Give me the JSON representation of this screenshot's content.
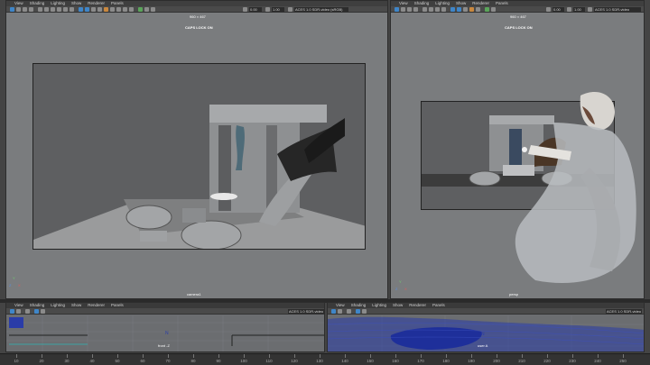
{
  "menus": [
    "View",
    "Shading",
    "Lighting",
    "Show",
    "Renderer",
    "Panels"
  ],
  "toolbar": {
    "field_a": "0.00",
    "field_b": "1.00",
    "color_mgmt": "ACES 1.0 SDR-video (sRGB)",
    "color_mgmt_short": "ACES 1.0 SDR-video"
  },
  "viewport_left": {
    "resolution": "960 × 467",
    "title": "CAPS LOCK ON",
    "camera": "camera1"
  },
  "viewport_right": {
    "resolution": "960 × 467",
    "title": "CAPS LOCK ON",
    "camera": "persp"
  },
  "graph_left": {
    "label": "front -Z"
  },
  "graph_right": {
    "label": "user A"
  },
  "axis_labels": {
    "y": "Y",
    "x": "X",
    "z": "Z"
  },
  "ruler": {
    "ticks": [
      "10",
      "20",
      "30",
      "40",
      "50",
      "60",
      "70",
      "80",
      "90",
      "100",
      "110",
      "120",
      "130",
      "140",
      "150",
      "160",
      "170",
      "180",
      "190",
      "200",
      "210",
      "220",
      "230",
      "240",
      "250"
    ]
  }
}
